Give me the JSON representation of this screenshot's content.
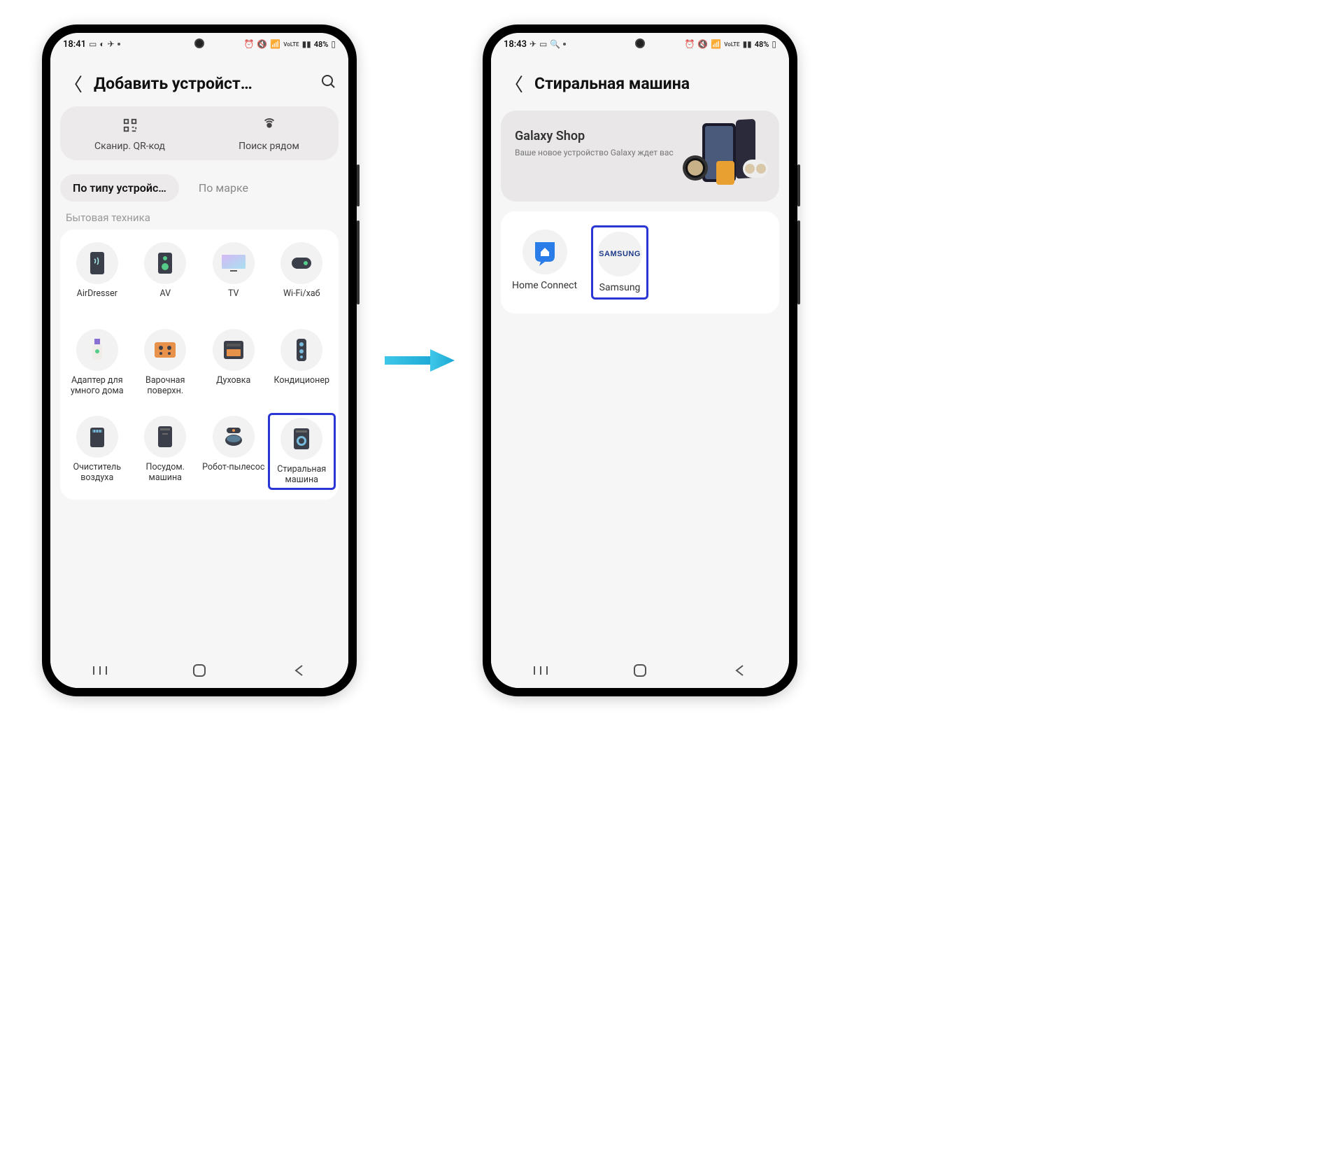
{
  "screen1": {
    "status": {
      "time": "18:41",
      "battery": "48%"
    },
    "title": "Добавить устройст…",
    "topActions": [
      {
        "label": "Сканир. QR-код"
      },
      {
        "label": "Поиск рядом"
      }
    ],
    "tabs": [
      {
        "label": "По типу устройс…",
        "active": true
      },
      {
        "label": "По марке",
        "active": false
      }
    ],
    "sectionLabel": "Бытовая техника",
    "devices": [
      {
        "label": "AirDresser"
      },
      {
        "label": "AV"
      },
      {
        "label": "TV"
      },
      {
        "label": "Wi-Fi/хаб"
      },
      {
        "label": "Адаптер для умного дома"
      },
      {
        "label": "Варочная поверхн."
      },
      {
        "label": "Духовка"
      },
      {
        "label": "Кондиционер"
      },
      {
        "label": "Очиститель воздуха"
      },
      {
        "label": "Посудом. машина"
      },
      {
        "label": "Робот-пылесос"
      },
      {
        "label": "Стиральная машина",
        "highlighted": true
      }
    ]
  },
  "screen2": {
    "status": {
      "time": "18:43",
      "battery": "48%"
    },
    "title": "Стиральная машина",
    "banner": {
      "title": "Galaxy Shop",
      "subtitle": "Ваше новое устройство Galaxy ждет вас"
    },
    "brands": [
      {
        "label": "Home Connect",
        "name": "home-connect"
      },
      {
        "label": "Samsung",
        "name": "samsung",
        "highlighted": true
      }
    ]
  }
}
